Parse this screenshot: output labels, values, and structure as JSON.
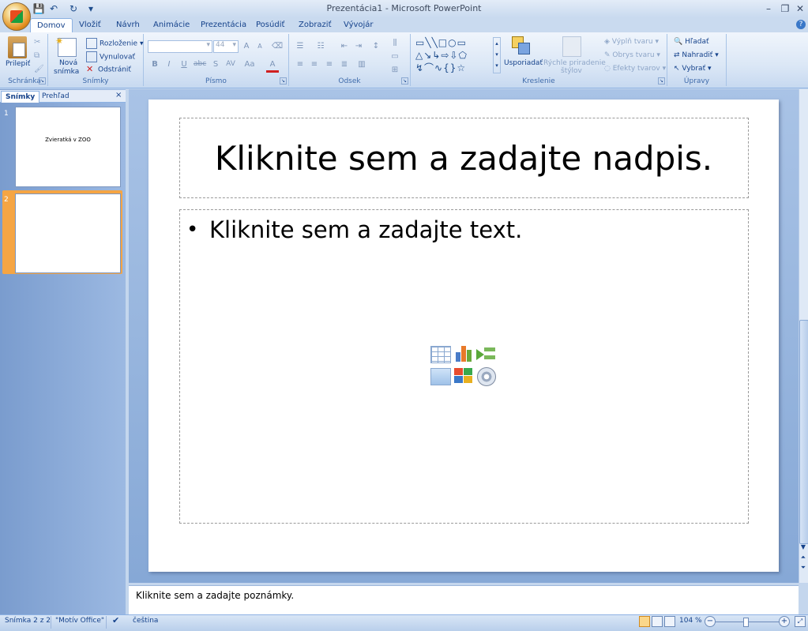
{
  "window": {
    "title": "Prezentácia1 - Microsoft PowerPoint",
    "controls": {
      "minimize": "–",
      "restore": "❐",
      "close": "✕"
    }
  },
  "quick_access": {
    "save": "💾",
    "undo": "↶",
    "redo": "↻",
    "more": "▾"
  },
  "tabs": [
    "Domov",
    "Vložiť",
    "Návrh",
    "Animácie",
    "Prezentácia",
    "Posúdiť",
    "Zobraziť",
    "Vývojár"
  ],
  "help": "?",
  "ribbon": {
    "clipboard": {
      "label": "Schránka",
      "paste": "Prilepiť"
    },
    "slides": {
      "label": "Snímky",
      "new_slide_line1": "Nová",
      "new_slide_line2": "snímka",
      "layout": "Rozloženie",
      "reset": "Vynulovať",
      "delete": "Odstrániť"
    },
    "font": {
      "label": "Písmo",
      "size": "44",
      "grow": "A",
      "shrink": "A",
      "bold": "B",
      "italic": "I",
      "underline": "U",
      "strike": "abc",
      "shadow": "S",
      "spacing": "AV",
      "case": "Aa",
      "color": "A"
    },
    "paragraph": {
      "label": "Odsek"
    },
    "drawing": {
      "label": "Kreslenie",
      "arrange": "Usporiadať",
      "quick_styles_line1": "Rýchle priradenie",
      "quick_styles_line2": "štýlov",
      "fill": "Výplň tvaru",
      "outline": "Obrys tvaru",
      "effects": "Efekty tvarov"
    },
    "editing": {
      "label": "Úpravy",
      "find": "Hľadať",
      "replace": "Nahradiť",
      "select": "Vybrať"
    }
  },
  "left_pane": {
    "tab_slides": "Snímky",
    "tab_outline": "Prehľad",
    "close": "×",
    "slides": [
      {
        "number": "1",
        "title": "Zvieratká v ZOO"
      },
      {
        "number": "2",
        "title": ""
      }
    ]
  },
  "slide": {
    "title_placeholder": "Kliknite sem a zadajte nadpis.",
    "body_placeholder": "Kliknite sem a zadajte text.",
    "bullet": "•"
  },
  "notes": {
    "placeholder": "Kliknite sem a zadajte poznámky."
  },
  "status": {
    "slide_count": "Snímka 2 z 2",
    "theme": "\"Motív Office\"",
    "language": "čeština",
    "zoom": "104 %",
    "zoom_minus": "−",
    "zoom_plus": "+"
  },
  "colors": {
    "accent": "#15428b",
    "ribbon": "#dbe7f6",
    "selected_thumb": "#f5a544"
  }
}
